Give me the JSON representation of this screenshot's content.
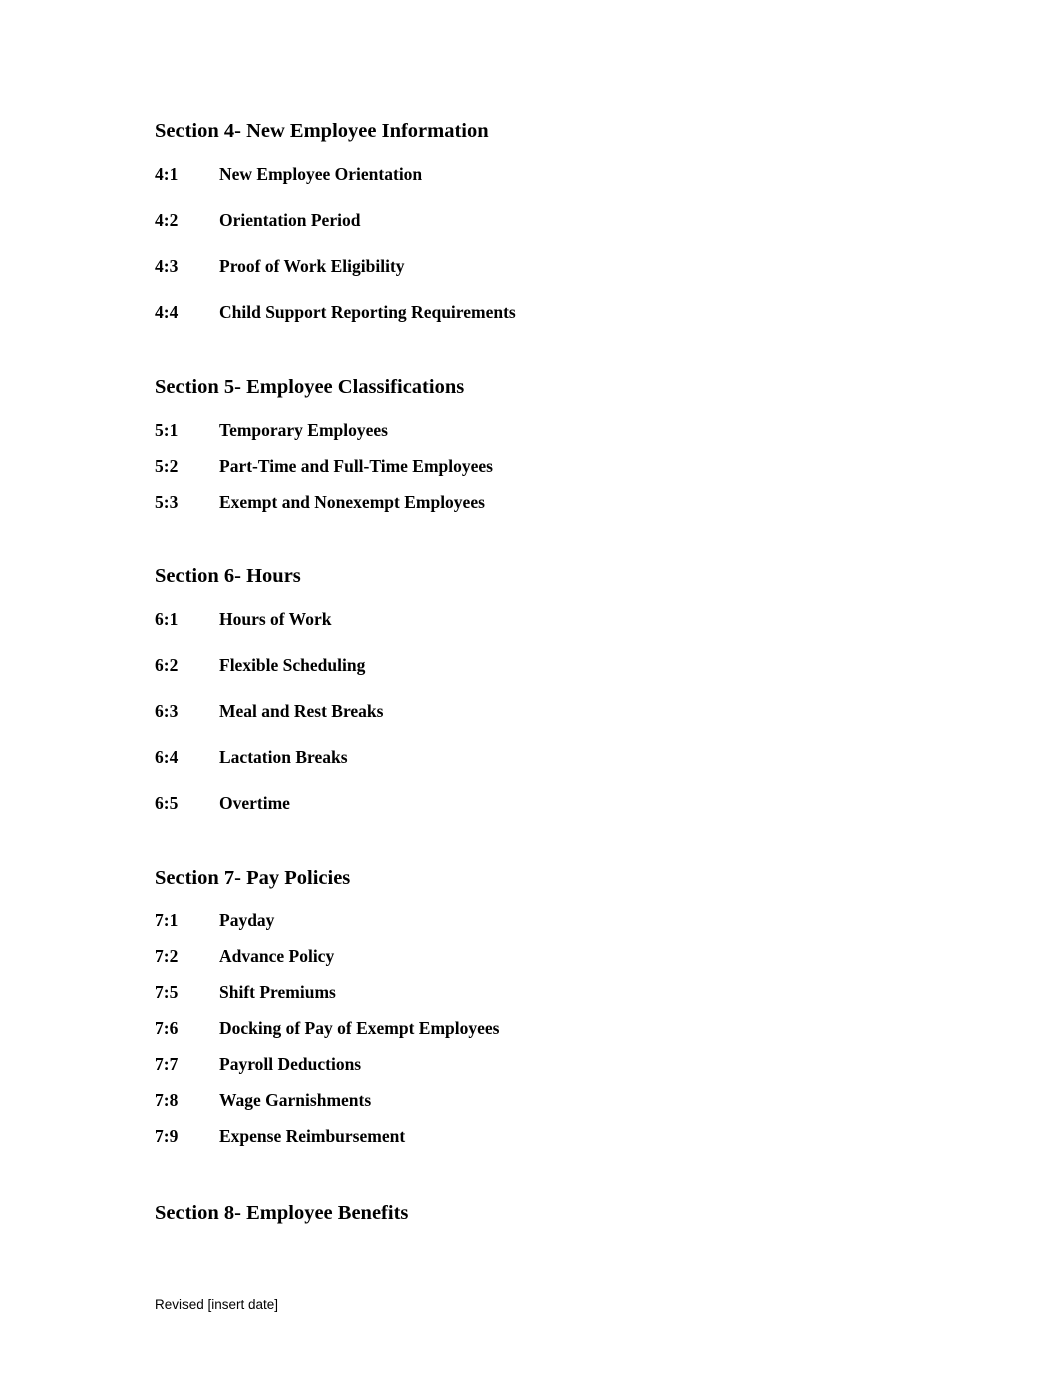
{
  "document": {
    "page_background": "#ffffff",
    "text_color": "#000000"
  },
  "sections": [
    {
      "heading": "Section 4- New Employee Information",
      "items": [
        {
          "number": "4:1",
          "title": "New Employee Orientation"
        },
        {
          "number": "4:2",
          "title": "Orientation Period"
        },
        {
          "number": "4:3",
          "title": "Proof of Work Eligibility"
        },
        {
          "number": "4:4",
          "title": "Child Support Reporting Requirements"
        }
      ]
    },
    {
      "heading": "Section 5- Employee Classifications",
      "items": [
        {
          "number": "5:1",
          "title": "Temporary Employees"
        },
        {
          "number": "5:2",
          "title": "Part-Time and Full-Time Employees"
        },
        {
          "number": "5:3",
          "title": "Exempt and Nonexempt Employees"
        }
      ]
    },
    {
      "heading": "Section 6- Hours",
      "items": [
        {
          "number": "6:1",
          "title": "Hours of Work"
        },
        {
          "number": "6:2",
          "title": "Flexible Scheduling"
        },
        {
          "number": "6:3",
          "title": "Meal and Rest Breaks"
        },
        {
          "number": "6:4",
          "title": "Lactation Breaks"
        },
        {
          "number": "6:5",
          "title": "Overtime"
        }
      ]
    },
    {
      "heading": "Section 7- Pay Policies",
      "items": [
        {
          "number": "7:1",
          "title": "Payday"
        },
        {
          "number": "7:2",
          "title": "Advance Policy"
        },
        {
          "number": "7:5",
          "title": "Shift Premiums"
        },
        {
          "number": "7:6",
          "title": "Docking of Pay of Exempt Employees"
        },
        {
          "number": "7:7",
          "title": "Payroll Deductions"
        },
        {
          "number": "7:8",
          "title": "Wage Garnishments"
        },
        {
          "number": "7:9",
          "title": "Expense Reimbursement"
        }
      ]
    },
    {
      "heading": "Section 8- Employee Benefits",
      "items": []
    }
  ],
  "footer": {
    "revised_note": "Revised [insert date]"
  }
}
